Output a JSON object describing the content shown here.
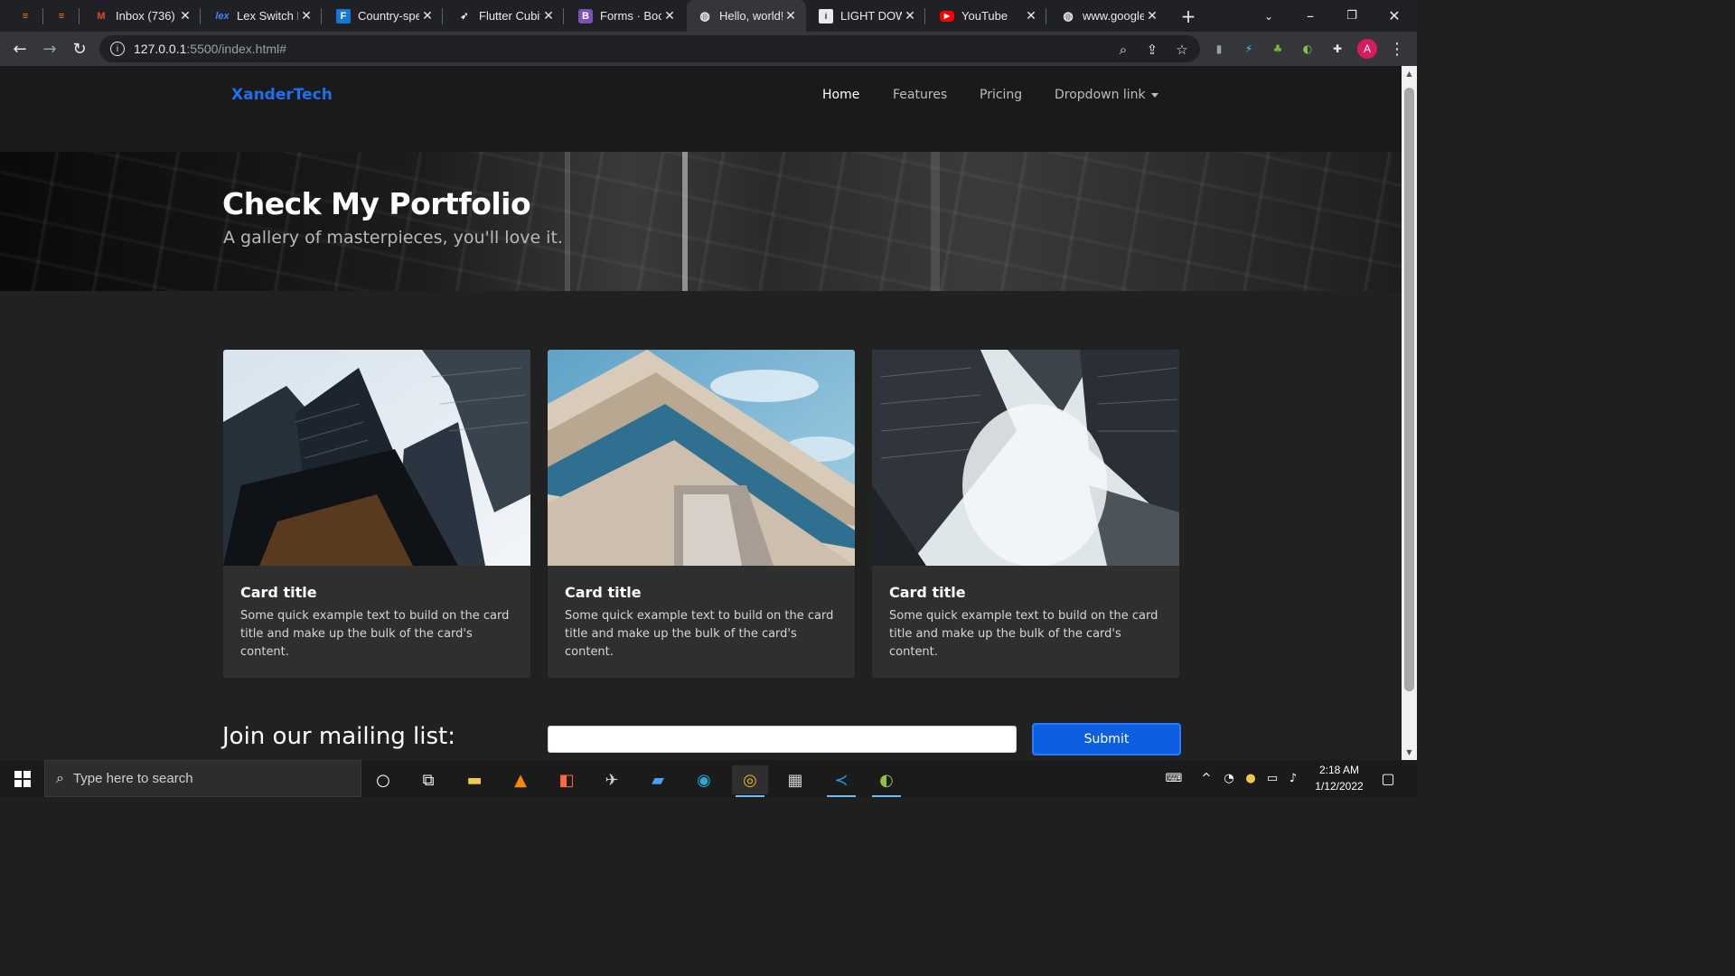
{
  "browser": {
    "tabs": [
      {
        "title": "",
        "icon": "stack-icon"
      },
      {
        "title": "",
        "icon": "stack-icon"
      },
      {
        "title": "Inbox (736) -",
        "icon": "gmail-icon"
      },
      {
        "title": "Lex Switch P",
        "icon": "lex-icon"
      },
      {
        "title": "Country-spe",
        "icon": "flutter-doc-icon"
      },
      {
        "title": "Flutter Cubit",
        "icon": "rocket-icon"
      },
      {
        "title": "Forms · Boot",
        "icon": "bootstrap-icon"
      },
      {
        "title": "Hello, world!",
        "icon": "globe-icon"
      },
      {
        "title": "LIGHT DOWN",
        "icon": "doc-icon"
      },
      {
        "title": "YouTube",
        "icon": "youtube-icon"
      },
      {
        "title": "www.google",
        "icon": "globe-icon"
      }
    ],
    "active_tab": 7,
    "url_host": "127.0.0.1",
    "url_path": ":5500/index.html#",
    "profile_initial": "A"
  },
  "site": {
    "brand": "XanderTech",
    "nav": {
      "home": "Home",
      "features": "Features",
      "pricing": "Pricing",
      "dropdown": "Dropdown link"
    },
    "hero": {
      "title": "Check My Portfolio",
      "subtitle": "A gallery of masterpieces, you'll love it."
    },
    "cards": [
      {
        "title": "Card title",
        "text": "Some quick example text to build on the card title and make up the bulk of the card's content."
      },
      {
        "title": "Card title",
        "text": "Some quick example text to build on the card title and make up the bulk of the card's content."
      },
      {
        "title": "Card title",
        "text": "Some quick example text to build on the card title and make up the bulk of the card's content."
      }
    ],
    "mailing": {
      "label": "Join our mailing list:",
      "input_value": "",
      "submit": "Submit"
    }
  },
  "taskbar": {
    "search_placeholder": "Type here to search",
    "time": "2:18 AM",
    "date": "1/12/2022"
  }
}
